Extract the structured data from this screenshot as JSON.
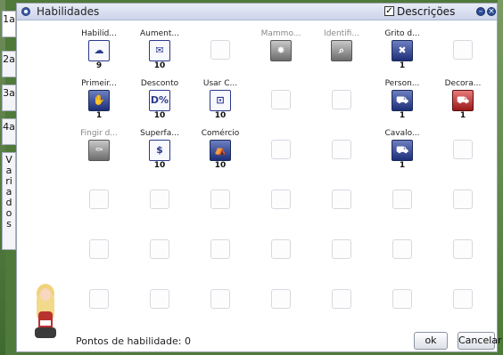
{
  "window": {
    "title": "Habilidades",
    "descricoes_label": "Descrições",
    "descricoes_checked": true,
    "minimize_symbol": "–",
    "close_symbol": "×"
  },
  "tabs": [
    {
      "label": "1a"
    },
    {
      "label": "2a"
    },
    {
      "label": "3a"
    },
    {
      "label": "4a"
    },
    {
      "label": "Variados"
    }
  ],
  "skills": [
    {
      "name": "Habilid...",
      "level": "9",
      "icon": "cloud-icon",
      "glyph": "☁",
      "style": "white",
      "col": 0,
      "row": 0
    },
    {
      "name": "Aument...",
      "level": "10",
      "icon": "cart-bag-icon",
      "glyph": "✉",
      "style": "white",
      "col": 1,
      "row": 0
    },
    {
      "name": "Mammo...",
      "level": "",
      "icon": "explosion-icon",
      "glyph": "✸",
      "style": "gray",
      "dim": true,
      "col": 3,
      "row": 0
    },
    {
      "name": "Identifi...",
      "level": "",
      "icon": "magnifier-icon",
      "glyph": "⌕",
      "style": "gray",
      "dim": true,
      "col": 4,
      "row": 0
    },
    {
      "name": "Grito d...",
      "level": "1",
      "icon": "shout-icon",
      "glyph": "✖",
      "style": "blue",
      "col": 5,
      "row": 0
    },
    {
      "name": "Primeir...",
      "level": "1",
      "icon": "hand-icon",
      "glyph": "✋",
      "style": "blue",
      "col": 0,
      "row": 1
    },
    {
      "name": "Desconto",
      "level": "10",
      "icon": "discount-icon",
      "glyph": "D%",
      "style": "white",
      "col": 1,
      "row": 1
    },
    {
      "name": "Usar C...",
      "level": "10",
      "icon": "cart-icon",
      "glyph": "⊡",
      "style": "white",
      "col": 2,
      "row": 1
    },
    {
      "name": "Person...",
      "level": "1",
      "icon": "cart-custom-icon",
      "glyph": "⛟",
      "style": "blue",
      "col": 5,
      "row": 1
    },
    {
      "name": "Decora...",
      "level": "1",
      "icon": "cart-decoration-icon",
      "glyph": "⛟",
      "style": "red",
      "col": 6,
      "row": 1
    },
    {
      "name": "Fingir d...",
      "level": "",
      "icon": "fake-death-icon",
      "glyph": "⚰",
      "style": "gray",
      "dim": true,
      "col": 0,
      "row": 2
    },
    {
      "name": "Superfa...",
      "level": "10",
      "icon": "overcharge-icon",
      "glyph": "$",
      "style": "white",
      "col": 1,
      "row": 2
    },
    {
      "name": "Comércio",
      "level": "10",
      "icon": "vending-icon",
      "glyph": "⛺",
      "style": "blue",
      "col": 2,
      "row": 2
    },
    {
      "name": "Cavalo...",
      "level": "1",
      "icon": "cart-boost-icon",
      "glyph": "⛟",
      "style": "blue",
      "col": 5,
      "row": 2
    }
  ],
  "footer": {
    "points_label": "Pontos de habilidade: 0",
    "ok_label": "ok",
    "cancel_label": "Cancelar"
  }
}
